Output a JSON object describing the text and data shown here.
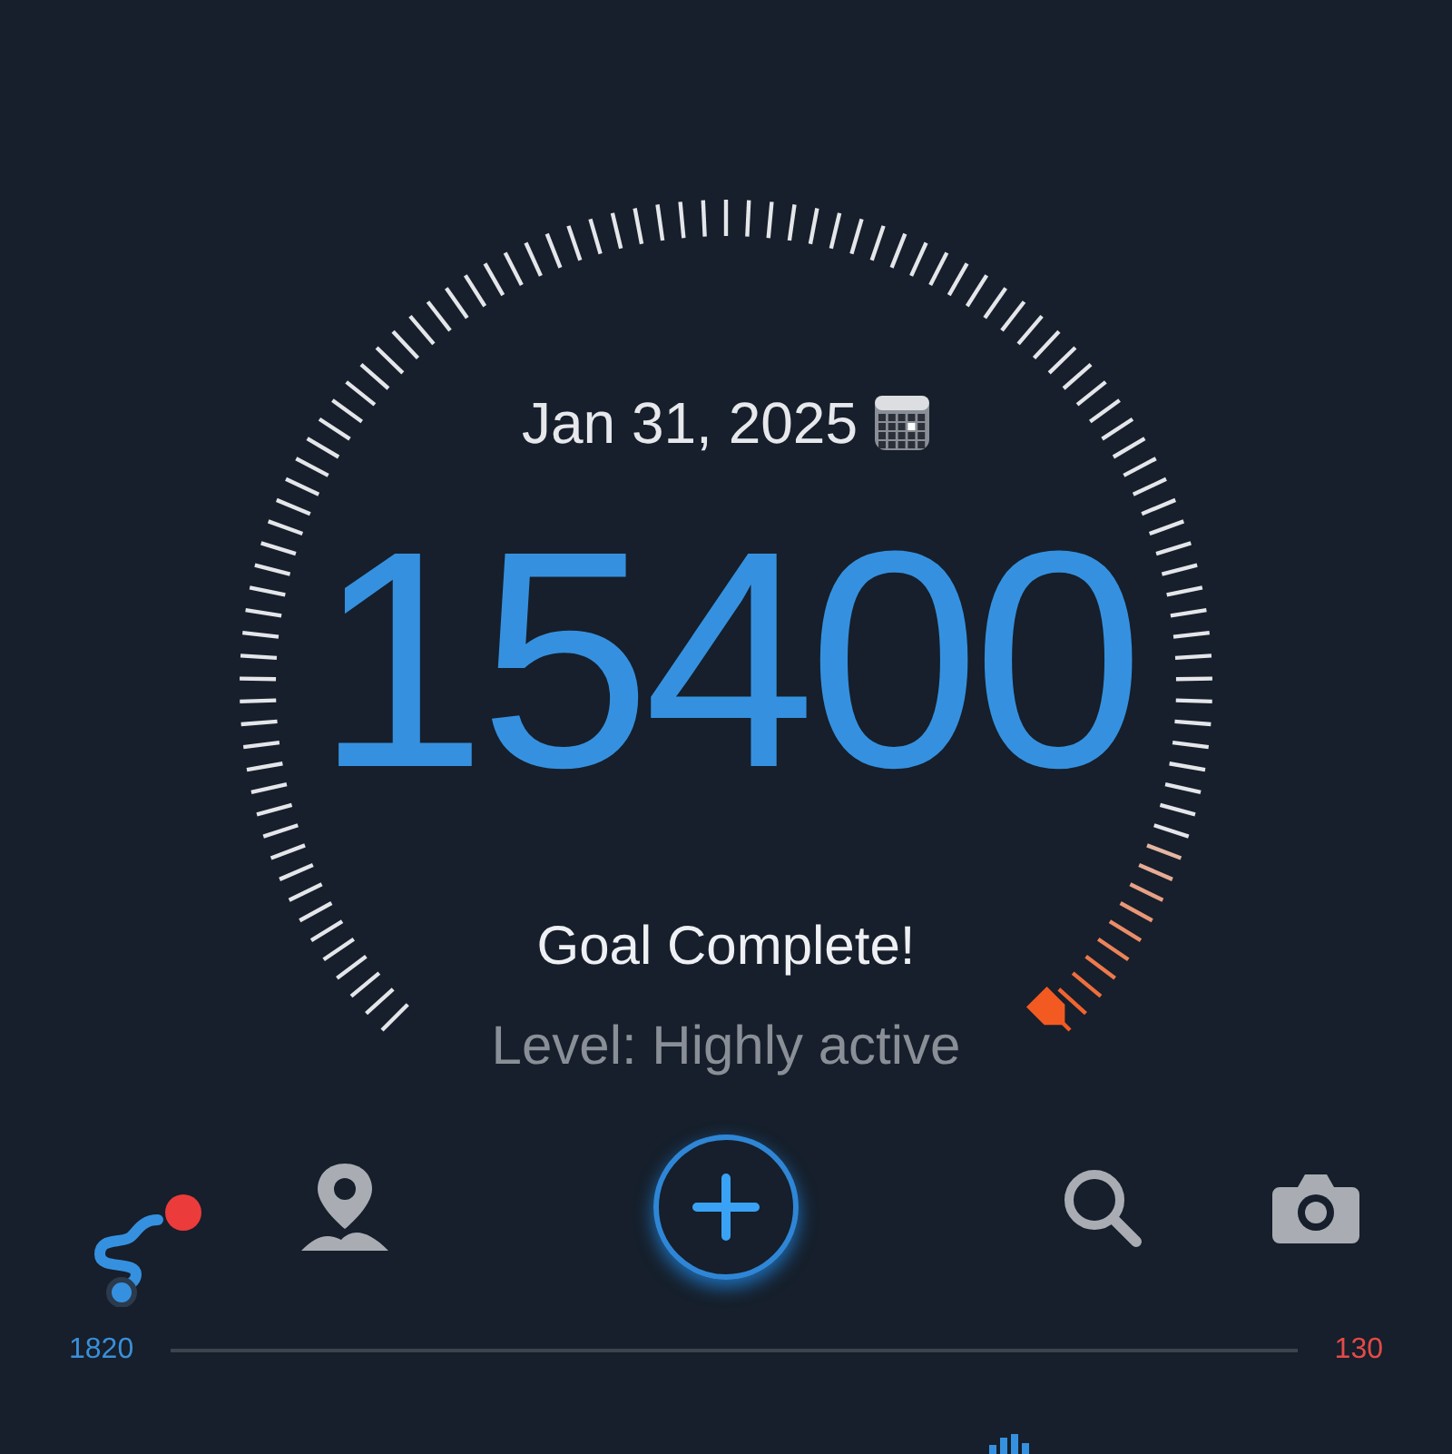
{
  "date": "Jan 31, 2025",
  "steps": "15400",
  "goal_status": "Goal Complete!",
  "activity_level": "Level: Highly active",
  "toolbar": [
    {
      "kind": "route",
      "notification": true
    },
    {
      "kind": "map",
      "notification": false
    },
    {
      "kind": "add",
      "notification": false
    },
    {
      "kind": "search",
      "notification": false
    },
    {
      "kind": "camera",
      "notification": false
    }
  ],
  "summary": {
    "left_value": "1820",
    "right_value": "130"
  }
}
